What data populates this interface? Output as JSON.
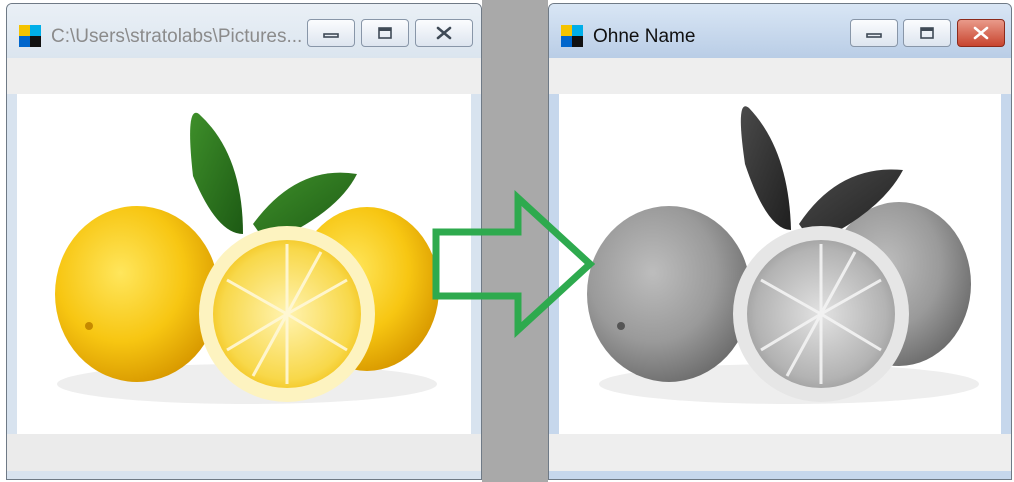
{
  "windows": {
    "left": {
      "title": "C:\\Users\\stratolabs\\Pictures...",
      "image_content": "lemons-color"
    },
    "right": {
      "title": "Ohne Name",
      "image_content": "lemons-grayscale"
    }
  },
  "window_controls": [
    "minimize-icon",
    "maximize-icon",
    "close-icon"
  ],
  "icons": {
    "app": "app-icon",
    "transition": "right-arrow-icon"
  },
  "colors": {
    "arrow": "#2eaa4e",
    "close_button_active": "#c8452f",
    "app_icon": [
      "#f4c300",
      "#00aee8",
      "#0066cc",
      "#111111"
    ]
  }
}
